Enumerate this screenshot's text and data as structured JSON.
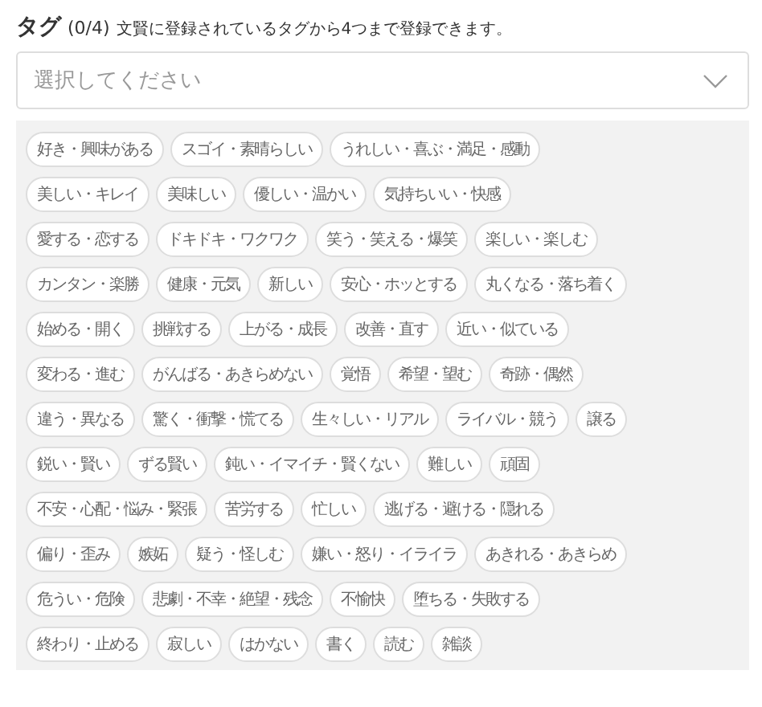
{
  "header": {
    "title": "タグ",
    "count": "(0/4)",
    "hint": "文賢に登録されているタグから4つまで登録できます。"
  },
  "select": {
    "placeholder": "選択してください"
  },
  "tag_rows": [
    [
      "好き・興味がある",
      "スゴイ・素晴らしい",
      "うれしい・喜ぶ・満足・感動"
    ],
    [
      "美しい・キレイ",
      "美味しい",
      "優しい・温かい",
      "気持ちいい・快感"
    ],
    [
      "愛する・恋する",
      "ドキドキ・ワクワク",
      "笑う・笑える・爆笑",
      "楽しい・楽しむ"
    ],
    [
      "カンタン・楽勝",
      "健康・元気",
      "新しい",
      "安心・ホッとする",
      "丸くなる・落ち着く"
    ],
    [
      "始める・開く",
      "挑戦する",
      "上がる・成長",
      "改善・直す",
      "近い・似ている"
    ],
    [
      "変わる・進む",
      "がんばる・あきらめない",
      "覚悟",
      "希望・望む",
      "奇跡・偶然"
    ],
    [
      "違う・異なる",
      "驚く・衝撃・慌てる",
      "生々しい・リアル",
      "ライバル・競う",
      "譲る"
    ],
    [
      "鋭い・賢い",
      "ずる賢い",
      "鈍い・イマイチ・賢くない",
      "難しい",
      "頑固"
    ],
    [
      "不安・心配・悩み・緊張",
      "苦労する",
      "忙しい",
      "逃げる・避ける・隠れる"
    ],
    [
      "偏り・歪み",
      "嫉妬",
      "疑う・怪しむ",
      "嫌い・怒り・イライラ",
      "あきれる・あきらめ"
    ],
    [
      "危うい・危険",
      "悲劇・不幸・絶望・残念",
      "不愉快",
      "堕ちる・失敗する"
    ],
    [
      "終わり・止める",
      "寂しい",
      "はかない",
      "書く",
      "読む",
      "雑談"
    ]
  ]
}
